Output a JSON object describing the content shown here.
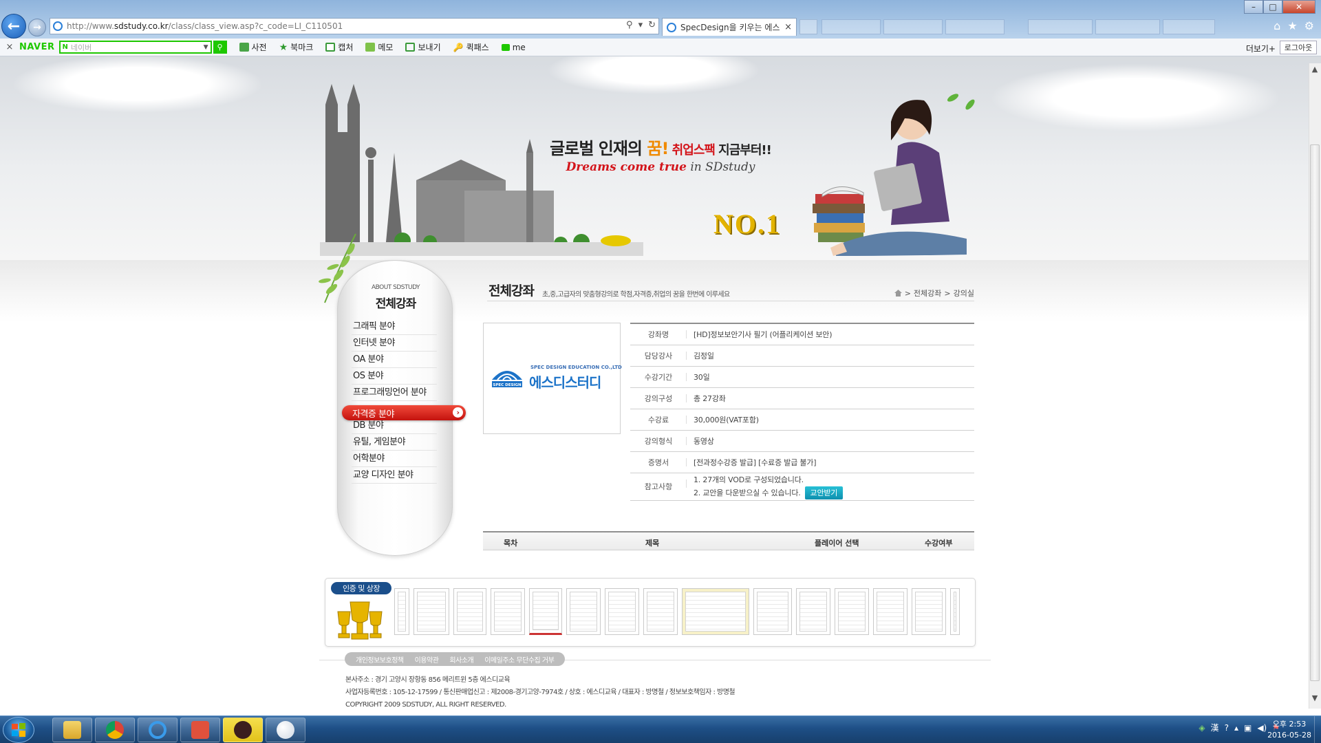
{
  "browser": {
    "url_prefix": "http://www.",
    "url_domain": "sdstudy.co.kr",
    "url_path": "/class/class_view.asp?c_code=LI_C110501",
    "tab_title": "SpecDesign을 키우는 에스...",
    "tab_close": "×",
    "back_arrow": "←",
    "forward_arrow": "→",
    "window_min": "–",
    "window_max": "□",
    "window_close": "✕"
  },
  "toolbar": {
    "close": "×",
    "naver_logo": "NAVER",
    "search_placeholder": "네이버",
    "items": [
      "사전",
      "북마크",
      "캡처",
      "메모",
      "보내기",
      "퀵패스",
      "me"
    ],
    "more": "더보기+",
    "login": "로그아웃"
  },
  "banner": {
    "slogan_main_1": "글로벌 인재의 ",
    "slogan_main_hl": "꿈!",
    "slogan_main_2": " 취업스팩",
    "slogan_main_3": " 지금부터!!",
    "slogan_sub_1": "Dreams come true",
    "slogan_sub_2": " in SDstudy",
    "rank": "NO.1"
  },
  "sidenav": {
    "subtitle": "ABOUT SDSTUDY",
    "title": "전체강좌",
    "items": [
      "그래픽 분야",
      "인터넷 분야",
      "OA 분야",
      "OS 분야",
      "프로그래밍언어 분야",
      "자격증 분야",
      "DB 분야",
      "유틸, 게임분야",
      "어학분야",
      "교양 디자인 분야"
    ],
    "active_index": 5
  },
  "content": {
    "title": "전체강좌",
    "description": "초,중,고급자의 맞춤형강의로 학점,자격증,취업의 꿈을 한번에 이루세요",
    "breadcrumb": [
      "전체강좌",
      "강의실"
    ],
    "breadcrumb_sep": ">"
  },
  "course_logo": {
    "en": "SPEC DESIGN EDUCATION CO.,LTD",
    "ko": "에스디스터디",
    "mark_text": "SPEC DESIGN"
  },
  "course_info": [
    {
      "label": "강좌명",
      "value": "[HD]정보보안기사 필기 (어플리케이션 보안)"
    },
    {
      "label": "담당강사",
      "value": "김정일"
    },
    {
      "label": "수강기간",
      "value": "30일"
    },
    {
      "label": "강의구성",
      "value": "총 27강좌"
    },
    {
      "label": "수강료",
      "value": "30,000원(VAT포함)"
    },
    {
      "label": "강의형식",
      "value": "동영상"
    },
    {
      "label": "증명서",
      "value": "[전과정수강증 발급] [수료증 발급 불가]"
    }
  ],
  "notes": {
    "label": "참고사항",
    "line1": "1. 27개의 VOD로 구성되었습니다.",
    "line2": "2. 교안을 다운받으실 수 있습니다.",
    "download_button": "교안받기"
  },
  "lesson_table": {
    "headers": [
      "목차",
      "제목",
      "플레이어 선택",
      "수강여부"
    ]
  },
  "certifications": {
    "label": "인증 및 상장"
  },
  "footer": {
    "links": [
      "개인정보보호정책",
      "이용약관",
      "회사소개",
      "이메일주소 무단수집 거부"
    ],
    "address": "본사주소 : 경기 고양시 장항동 856 메리트윈 5층 에스디교육",
    "business": "사업자등록번호 : 105-12-17599 / 통신판매업신고 : 제2008-경기고양-7974호 / 상호 : 에스디교육 / 대표자 : 방명철 / 정보보호책임자 : 방명철",
    "copyright": "COPYRIGHT 2009 SDSTUDY, ALL RIGHT RESERVED."
  },
  "scrollbar": {
    "up": "▲",
    "down": "▼"
  },
  "taskbar": {
    "tray_lang": "漢",
    "clock_time": "오후 2:53",
    "clock_date": "2016-05-28"
  },
  "colors": {
    "accent_red": "#c4120e",
    "naver_green": "#1ec800",
    "logo_blue": "#1c73c8",
    "button_teal": "#0e8fae"
  }
}
